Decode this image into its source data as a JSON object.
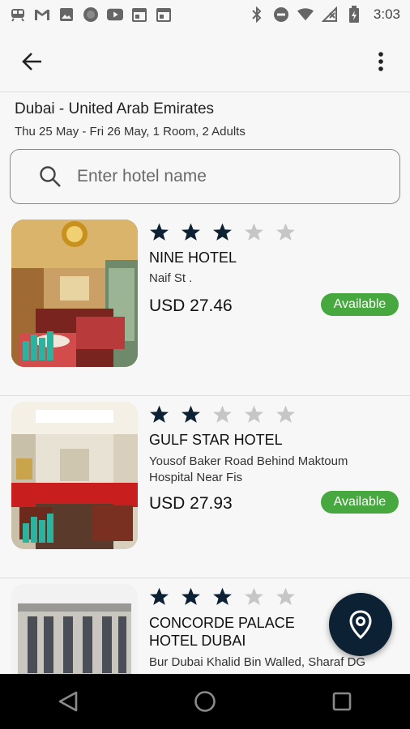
{
  "status_bar": {
    "time": "3:03",
    "left_icons": [
      "train-icon",
      "gmail-icon",
      "image-icon",
      "circle-icon",
      "youtube-icon",
      "calendar-icon",
      "calendar-icon"
    ],
    "right_icons": [
      "bluetooth-icon",
      "do-not-disturb-icon",
      "wifi-icon",
      "no-signal-icon",
      "battery-charging-icon"
    ]
  },
  "search_context": {
    "destination": "Dubai - United Arab Emirates",
    "dates_info": "Thu 25 May - Fri 26 May, 1 Room, 2 Adults"
  },
  "search": {
    "placeholder": "Enter hotel name"
  },
  "hotels": [
    {
      "name": "NINE HOTEL",
      "address": "Naif St .",
      "price": "USD 27.46",
      "availability": "Available",
      "rating": 3
    },
    {
      "name": "GULF STAR HOTEL",
      "address": "Yousof Baker Road Behind Maktoum Hospital Near Fis",
      "price": "USD 27.93",
      "availability": "Available",
      "rating": 2
    },
    {
      "name": "CONCORDE PALACE HOTEL DUBAI",
      "address": "Bur Dubai Khalid Bin Walled, Sharaf DG",
      "rating": 3
    }
  ],
  "colors": {
    "star_filled": "#0d2134",
    "star_empty": "#c6c6c6",
    "available_badge": "#46a83f",
    "fab": "#0d2134"
  }
}
